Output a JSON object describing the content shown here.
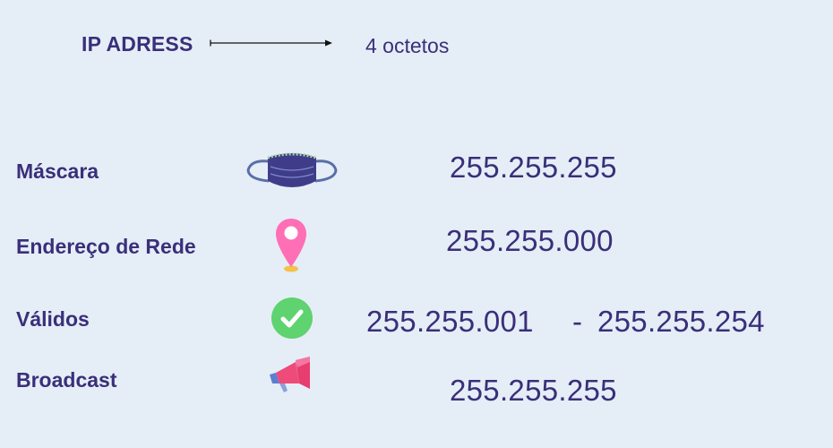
{
  "header": {
    "title": "IP ADRESS",
    "subtitle": "4 octetos"
  },
  "colors": {
    "background": "#e5eef6",
    "text": "#3a2f7a",
    "mask": "#3f3d8a",
    "pin": "#ff6fb5",
    "check": "#5ed36f",
    "megaphone": "#ee4a7a"
  },
  "rows": [
    {
      "label": "Máscara",
      "icon": "face-mask-icon",
      "value": "255.255.255"
    },
    {
      "label": "Endereço de Rede",
      "icon": "location-pin-icon",
      "value": "255.255.000"
    },
    {
      "label": "Válidos",
      "icon": "check-circle-icon",
      "value_start": "255.255.001",
      "separator": "-",
      "value_end": "255.255.254"
    },
    {
      "label": "Broadcast",
      "icon": "megaphone-icon",
      "value": "255.255.255"
    }
  ]
}
